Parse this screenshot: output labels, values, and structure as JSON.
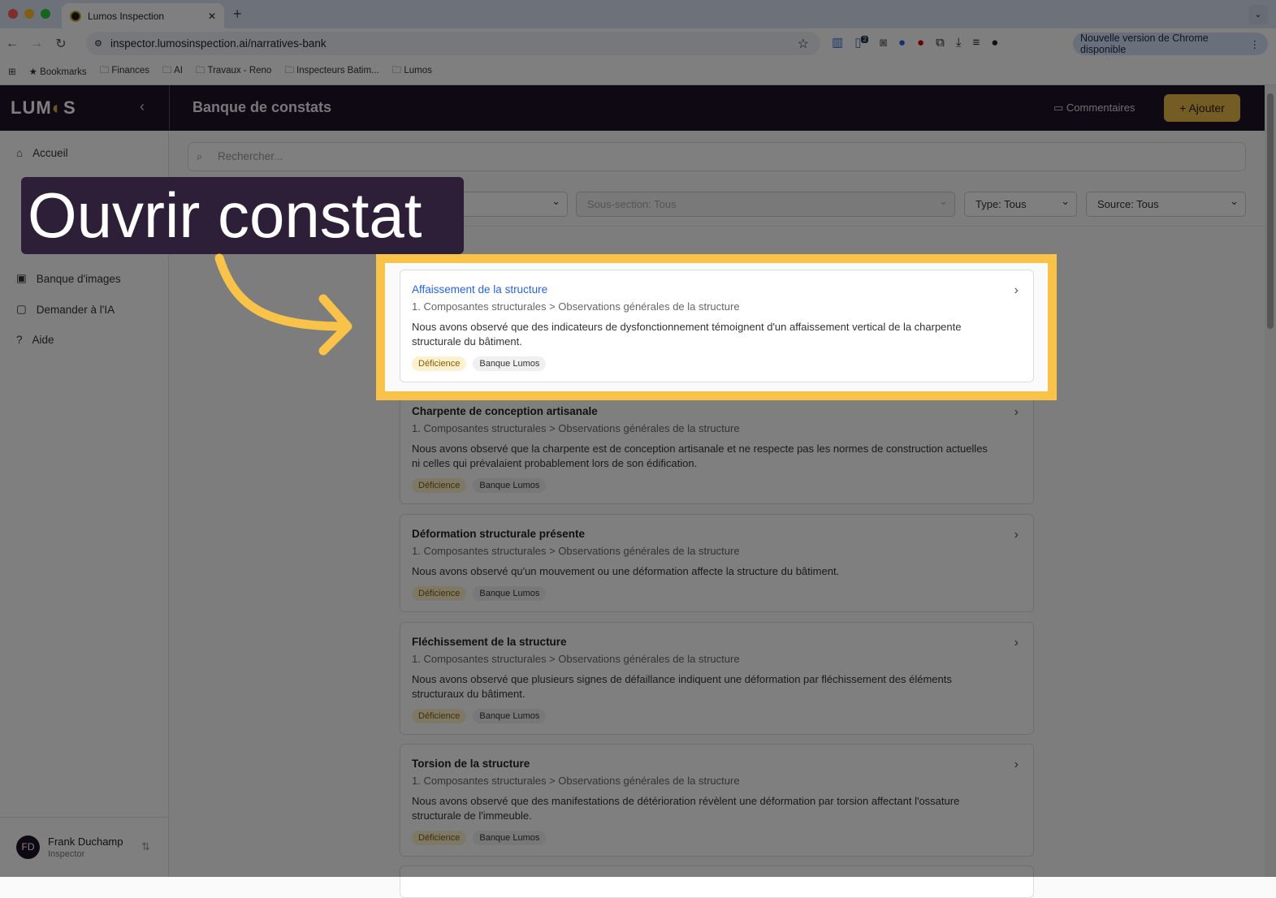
{
  "browser": {
    "tab_title": "Lumos Inspection",
    "url": "inspector.lumosinspection.ai/narratives-bank",
    "update_label": "Nouvelle version de Chrome disponible",
    "ext_badge": "2",
    "bookmarks": [
      "Bookmarks",
      "Finances",
      "AI",
      "Travaux - Reno",
      "Inspecteurs Batim...",
      "Lumos"
    ]
  },
  "app": {
    "logo": "LUMOS",
    "page_title": "Banque de constats",
    "comments_label": "Commentaires",
    "add_label": "Ajouter"
  },
  "sidebar": {
    "items": [
      {
        "label": "Accueil",
        "icon": "home-icon"
      },
      {
        "label": "Banque d'images",
        "icon": "image-icon"
      },
      {
        "label": "Demander à l'IA",
        "icon": "chat-icon"
      },
      {
        "label": "Aide",
        "icon": "help-icon"
      }
    ],
    "user": {
      "initials": "FD",
      "name": "Frank Duchamp",
      "role": "Inspector"
    }
  },
  "search": {
    "placeholder": "Rechercher..."
  },
  "filters": {
    "subsection": "Sous-section: Tous",
    "type": "Type: Tous",
    "source": "Source: Tous"
  },
  "callout": {
    "text": "Ouvrir constat"
  },
  "cards": [
    {
      "title": "Affaissement de la structure",
      "path": "1. Composantes structurales > Observations générales de la structure",
      "desc": "Nous avons observé que des indicateurs de dysfonctionnement témoignent d'un affaissement vertical de la charpente structurale du bâtiment.",
      "tags": [
        "Déficience",
        "Banque Lumos"
      ]
    },
    {
      "title": "Charpente de conception artisanale",
      "path": "1. Composantes structurales > Observations générales de la structure",
      "desc": "Nous avons observé que la charpente est de conception artisanale et ne respecte pas les normes de construction actuelles ni celles qui prévalaient probablement lors de son édification.",
      "tags": [
        "Déficience",
        "Banque Lumos"
      ]
    },
    {
      "title": "Déformation structurale présente",
      "path": "1. Composantes structurales > Observations générales de la structure",
      "desc": "Nous avons observé qu'un mouvement ou une déformation affecte la structure du bâtiment.",
      "tags": [
        "Déficience",
        "Banque Lumos"
      ]
    },
    {
      "title": "Fléchissement de la structure",
      "path": "1. Composantes structurales > Observations générales de la structure",
      "desc": "Nous avons observé que plusieurs signes de défaillance indiquent une déformation par fléchissement des éléments structuraux du bâtiment.",
      "tags": [
        "Déficience",
        "Banque Lumos"
      ]
    },
    {
      "title": "Torsion de la structure",
      "path": "1. Composantes structurales > Observations générales de la structure",
      "desc": "Nous avons observé que des manifestations de détérioration révèlent une déformation par torsion affectant l'ossature structurale de l'immeuble.",
      "tags": [
        "Déficience",
        "Banque Lumos"
      ]
    }
  ],
  "colors": {
    "brand_dark": "#1e1329",
    "accent": "#e8b94a",
    "highlight": "#f9c34a",
    "link": "#2563eb"
  }
}
